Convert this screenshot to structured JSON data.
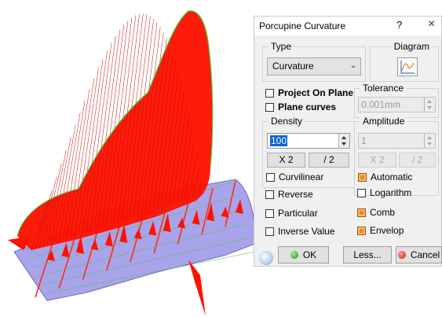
{
  "dialog": {
    "title": "Porcupine Curvature",
    "help": "?",
    "close": "×",
    "type_group": {
      "label": "Type",
      "selected": "Curvature"
    },
    "diagram_group": {
      "label": "Diagram"
    },
    "project_on_plane": {
      "label": "Project On Plane",
      "checked": false
    },
    "plane_curves": {
      "label": "Plane curves",
      "checked": false
    },
    "tolerance_group": {
      "label": "Tolerance",
      "value": "0.001mm",
      "enabled": false
    },
    "density_group": {
      "label": "Density",
      "value": "100",
      "multiply_label": "X 2",
      "divide_label": "/ 2",
      "curvilinear": {
        "label": "Curvilinear",
        "checked": false
      }
    },
    "amplitude_group": {
      "label": "Amplitude",
      "value": "1",
      "enabled": false,
      "multiply_label": "X 2",
      "divide_label": "/ 2",
      "automatic": {
        "label": "Automatic",
        "checked": true
      },
      "logarithm": {
        "label": "Logarithm",
        "checked": false
      }
    },
    "reverse": {
      "label": "Reverse",
      "checked": false
    },
    "particular": {
      "label": "Particular",
      "checked": false
    },
    "inverse_value": {
      "label": "Inverse Value",
      "checked": false
    },
    "comb": {
      "label": "Comb",
      "checked": true
    },
    "envelop": {
      "label": "Envelop",
      "checked": true
    },
    "buttons": {
      "ok": "OK",
      "less": "Less...",
      "cancel": "Cancel"
    }
  },
  "colors": {
    "comb": "#ff1200",
    "surface": "#a9a3ec",
    "envelope": "#4cc84c",
    "checkbox_on": "#e8891f"
  },
  "icons": {
    "diagram": "curvature-diagram-icon",
    "ok": "green-ok-icon",
    "cancel": "red-cancel-icon"
  }
}
